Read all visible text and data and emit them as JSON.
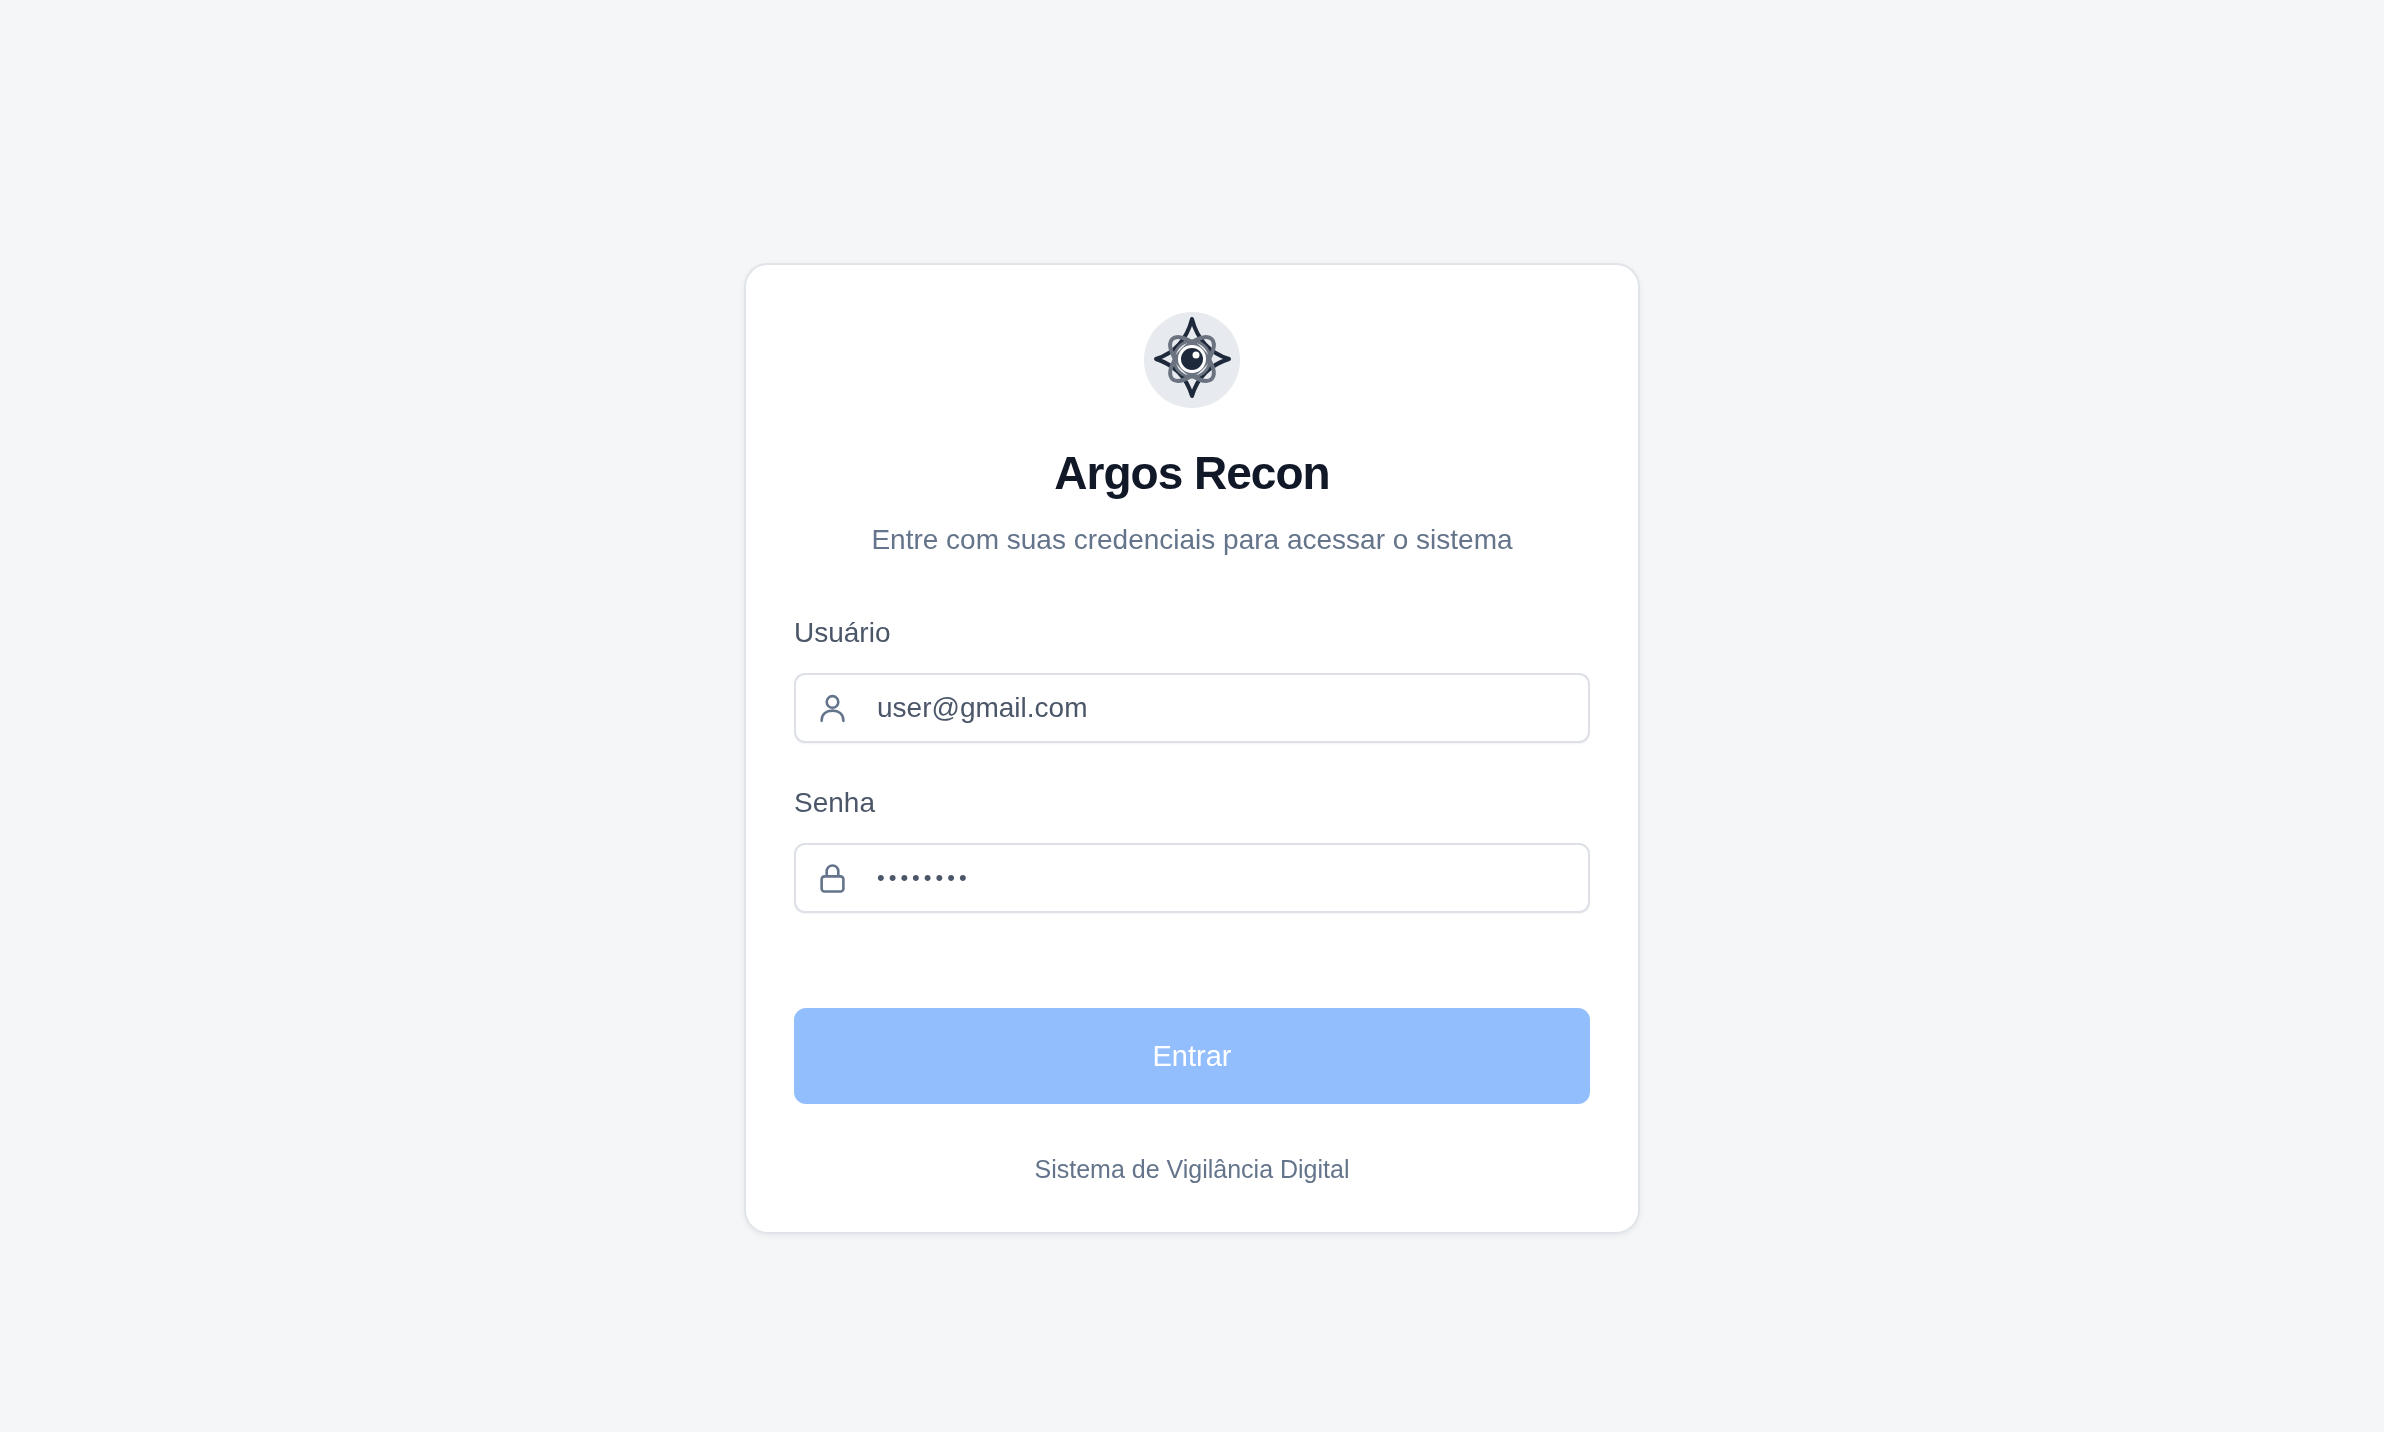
{
  "title": "Argos Recon",
  "subtitle": "Entre com suas credenciais para acessar o sistema",
  "fields": [
    {
      "kind": "text",
      "label": "Usuário",
      "value": "user@gmail.com"
    },
    {
      "kind": "password",
      "label": "Senha",
      "value": "••••••••"
    }
  ],
  "submit_button": {
    "label": "Entrar",
    "disabled": true
  },
  "footer": "Sistema de Vigilância Digital"
}
